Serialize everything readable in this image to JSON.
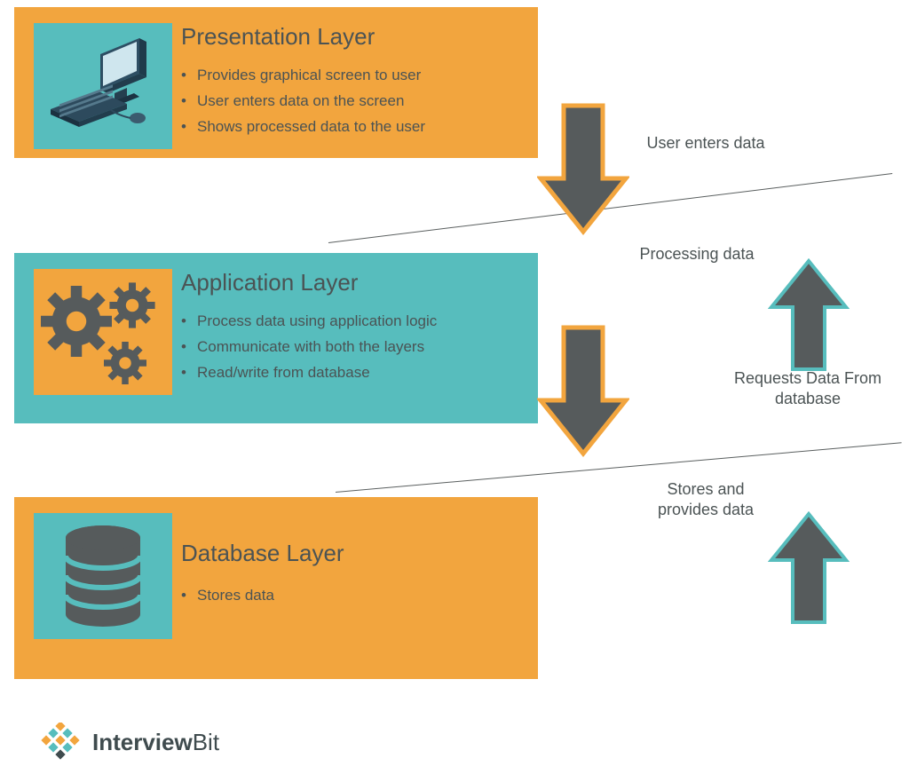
{
  "layers": {
    "presentation": {
      "title": "Presentation Layer",
      "points": [
        "Provides graphical screen to user",
        "User enters data on the screen",
        "Shows processed data to the user"
      ]
    },
    "application": {
      "title": "Application Layer",
      "points": [
        "Process data using application logic",
        "Communicate with both the layers",
        "Read/write from database"
      ]
    },
    "database": {
      "title": "Database Layer",
      "points": [
        "Stores data"
      ]
    }
  },
  "labels": {
    "user_enters": "User enters data",
    "processing": "Processing data",
    "requests": "Requests Data From database",
    "stores": "Stores and provides data"
  },
  "brand": {
    "bold": "Interview",
    "light": "Bit"
  },
  "colors": {
    "orange": "#f2a53e",
    "teal": "#57bdbd",
    "ink": "#525959"
  }
}
